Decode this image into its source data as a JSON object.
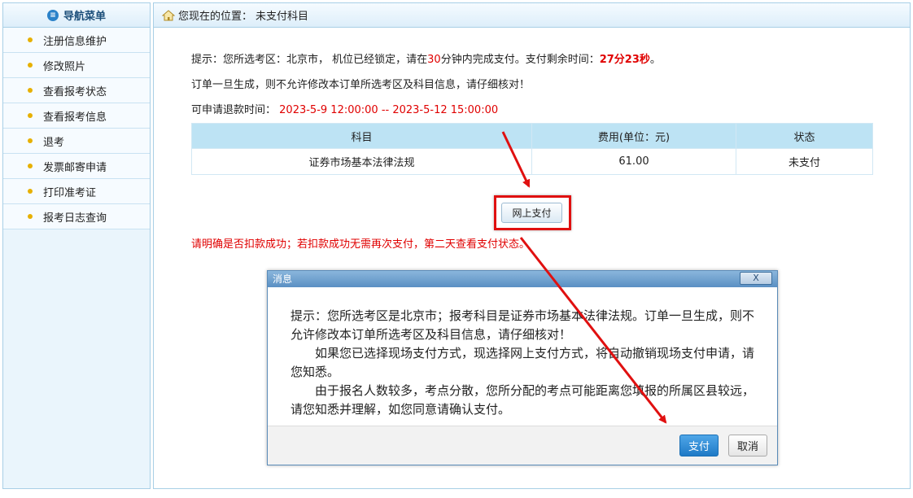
{
  "sidebar": {
    "title": "导航菜单",
    "items": [
      {
        "label": "注册信息维护"
      },
      {
        "label": "修改照片"
      },
      {
        "label": "查看报考状态"
      },
      {
        "label": "查看报考信息"
      },
      {
        "label": "退考"
      },
      {
        "label": "发票邮寄申请"
      },
      {
        "label": "打印准考证"
      },
      {
        "label": "报考日志查询"
      }
    ]
  },
  "breadcrumb": {
    "prefix": "您现在的位置：",
    "current": "未支付科目"
  },
  "notice": {
    "line1_a": "提示：您所选考区：北京市，  机位已经锁定，请在",
    "minutes": "30",
    "line1_b": "分钟内完成支付。支付剩余时间：",
    "remaining": "27分23秒",
    "line1_c": "。",
    "line2": "订单一旦生成，则不允许修改本订单所选考区及科目信息，请仔细核对！",
    "refund_label": "可申请退款时间：",
    "refund_period": "2023-5-9 12:00:00 -- 2023-5-12 15:00:00"
  },
  "table": {
    "headers": [
      "科目",
      "费用(单位：元)",
      "状态"
    ],
    "rows": [
      [
        "证券市场基本法律法规",
        "61.00",
        "未支付"
      ]
    ]
  },
  "pay_button": "网上支付",
  "warning": "请明确是否扣款成功；若扣款成功无需再次支付，第二天查看支付状态。",
  "dialog": {
    "title": "消息",
    "close": "X",
    "para1": "提示：您所选考区是北京市；报考科目是证券市场基本法律法规。订单一旦生成，则不允许修改本订单所选考区及科目信息，请仔细核对！",
    "para2": "如果您已选择现场支付方式，现选择网上支付方式，将自动撤销现场支付申请，请您知悉。",
    "para3": "由于报名人数较多，考点分散，您所分配的考点可能距离您填报的所属区县较远，请您知悉并理解，如您同意请确认支付。",
    "confirm": "支付",
    "cancel": "取消"
  },
  "colors": {
    "accent_red": "#e00000",
    "table_header": "#bde3f4",
    "sidebar_bg": "#eaf5fc",
    "dialog_title": "#5a8fc3",
    "annotation_arrow": "#e01010"
  },
  "icons": {
    "nav_header": "list-icon",
    "breadcrumb": "home-icon"
  }
}
